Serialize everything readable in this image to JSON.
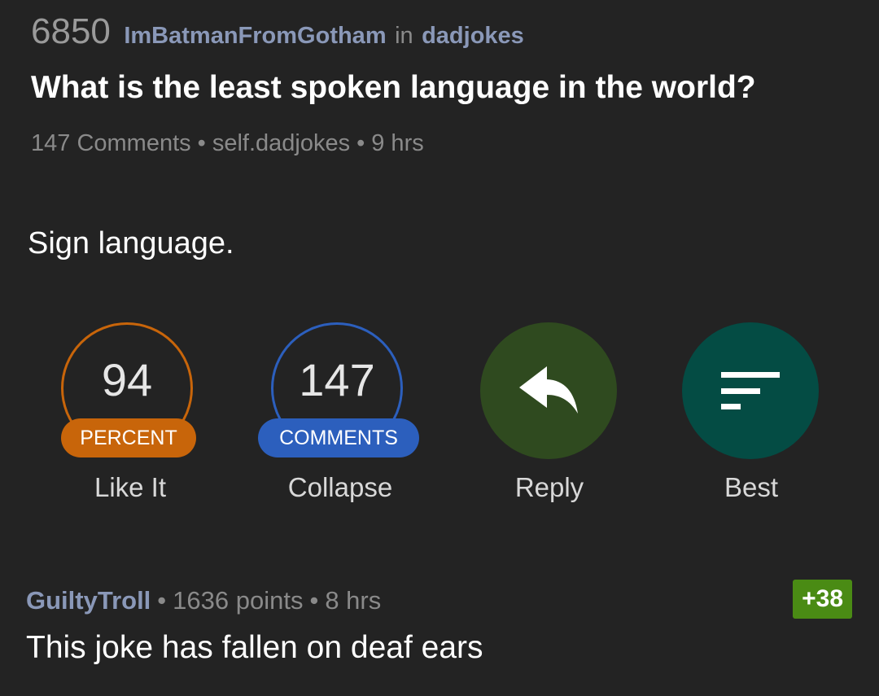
{
  "post": {
    "score": "6850",
    "author": "ImBatmanFromGotham",
    "in_word": "in",
    "subreddit": "dadjokes",
    "title": "What is the least spoken language in the world?",
    "comments_count": "147 Comments",
    "domain": "self.dadjokes",
    "age": "9 hrs",
    "separator": "•",
    "body": "Sign language."
  },
  "actions": {
    "like": {
      "value": "94",
      "pill": "PERCENT",
      "label": "Like It",
      "color": "#c8650a"
    },
    "collapse": {
      "value": "147",
      "pill": "COMMENTS",
      "label": "Collapse",
      "color": "#2c5fbd"
    },
    "reply": {
      "label": "Reply",
      "icon": "reply-arrow-icon",
      "color": "#2f4a1f"
    },
    "best": {
      "label": "Best",
      "icon": "sort-icon",
      "color": "#044c44"
    }
  },
  "comment": {
    "author": "GuiltyTroll",
    "points": "1636 points",
    "age": "8 hrs",
    "separator": "•",
    "badge": "+38",
    "badge_color": "#4a8b14",
    "text": "This joke has fallen on deaf ears"
  }
}
